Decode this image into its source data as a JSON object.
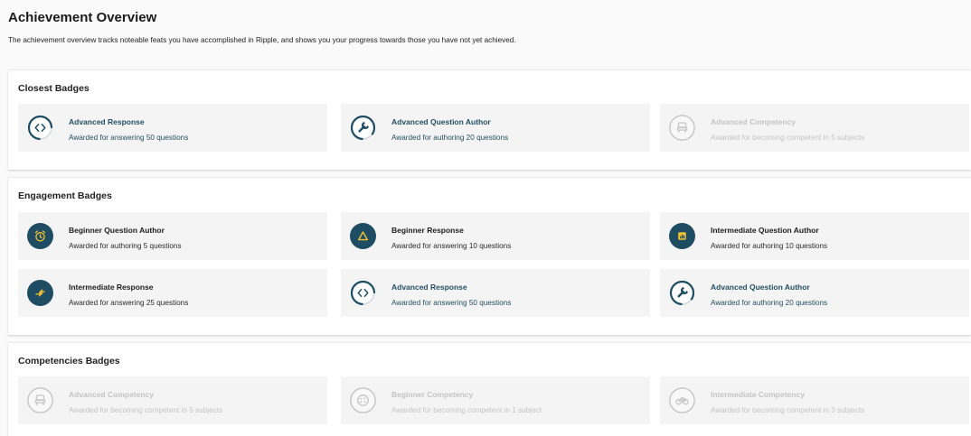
{
  "page": {
    "title": "Achievement Overview",
    "description": "The achievement overview tracks noteable feats you have accomplished in Ripple, and shows you your progress towards those you have not yet achieved."
  },
  "colors": {
    "badge_dark": "#1e4d63",
    "badge_accent_yellow": "#f2c230",
    "locked_gray": "#c4c4c4",
    "blue_text": "#244e63"
  },
  "sections": [
    {
      "title": "Closest Badges",
      "badges": [
        {
          "title": "Advanced Response",
          "description": "Awarded for answering 50 questions",
          "icon": "code-brackets-icon",
          "state": "in-progress",
          "progress": 0.75
        },
        {
          "title": "Advanced Question Author",
          "description": "Awarded for authoring 20 questions",
          "icon": "wrench-icon",
          "state": "in-progress",
          "progress": 0.85
        },
        {
          "title": "Advanced Competency",
          "description": "Awarded for becoming competent in 5 subjects",
          "icon": "chair-icon",
          "state": "locked"
        }
      ]
    },
    {
      "title": "Engagement Badges",
      "badges": [
        {
          "title": "Beginner Question Author",
          "description": "Awarded for authoring 5 questions",
          "icon": "alarm-clock-icon",
          "state": "earned"
        },
        {
          "title": "Beginner Response",
          "description": "Awarded for answering 10 questions",
          "icon": "triangle-icon",
          "state": "earned"
        },
        {
          "title": "Intermediate Question Author",
          "description": "Awarded for authoring 10 questions",
          "icon": "bar-chart-icon",
          "state": "earned"
        },
        {
          "title": "Intermediate Response",
          "description": "Awarded for answering 25 questions",
          "icon": "swap-arrows-icon",
          "state": "earned"
        },
        {
          "title": "Advanced Response",
          "description": "Awarded for answering 50 questions",
          "icon": "code-brackets-icon",
          "state": "in-progress",
          "progress": 0.75
        },
        {
          "title": "Advanced Question Author",
          "description": "Awarded for authoring 20 questions",
          "icon": "wrench-icon",
          "state": "in-progress",
          "progress": 0.85
        }
      ]
    },
    {
      "title": "Competencies Badges",
      "badges": [
        {
          "title": "Advanced Competency",
          "description": "Awarded for becoming competent in 5 subjects",
          "icon": "chair-icon",
          "state": "locked"
        },
        {
          "title": "Beginner Competency",
          "description": "Awarded for becoming competent in 1 subject",
          "icon": "palette-icon",
          "state": "locked"
        },
        {
          "title": "Intermediate Competency",
          "description": "Awarded for becoming competent in 3 subjects",
          "icon": "bicycle-icon",
          "state": "locked"
        }
      ]
    }
  ]
}
